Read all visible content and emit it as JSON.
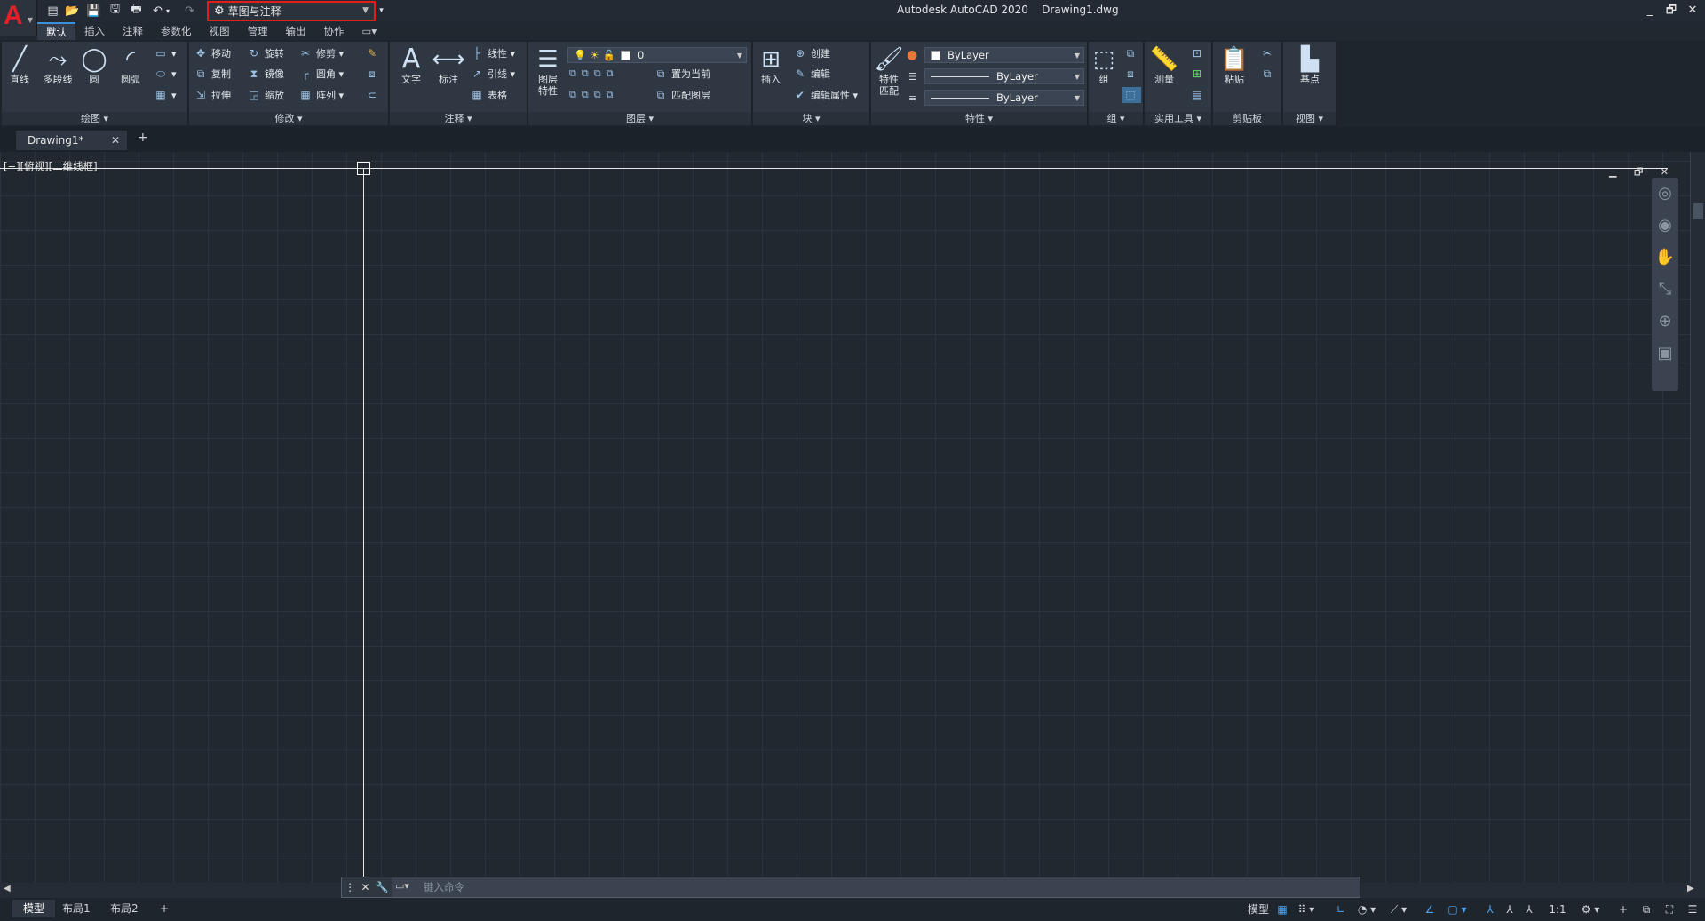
{
  "app": {
    "logo": "A",
    "title": "Autodesk AutoCAD 2020    Drawing1.dwg"
  },
  "workspace": {
    "name": "草图与注释"
  },
  "ribbon_tabs": [
    "默认",
    "插入",
    "注释",
    "参数化",
    "视图",
    "管理",
    "输出",
    "协作"
  ],
  "draw": {
    "line": "直线",
    "polyline": "多段线",
    "circle": "圆",
    "arc": "圆弧",
    "footer": "绘图 ▾"
  },
  "modify": {
    "move": "移动",
    "rotate": "旋转",
    "trim": "修剪",
    "copy": "复制",
    "mirror": "镜像",
    "fillet": "圆角",
    "stretch": "拉伸",
    "scale": "缩放",
    "array": "阵列",
    "footer": "修改 ▾"
  },
  "annotation": {
    "text": "文字",
    "dimension": "标注",
    "linear": "线性",
    "leader": "引线",
    "table": "表格",
    "footer": "注释 ▾"
  },
  "layers": {
    "properties": "图层\n特性",
    "current_layer": "0",
    "make_current": "置为当前",
    "match_layer": "匹配图层",
    "footer": "图层 ▾"
  },
  "block": {
    "insert": "插入",
    "create": "创建",
    "edit": "编辑",
    "edit_attributes": "编辑属性",
    "footer": "块 ▾"
  },
  "properties": {
    "match": "特性\n匹配",
    "color": "ByLayer",
    "linetype": "ByLayer",
    "lineweight": "ByLayer",
    "footer": "特性 ▾"
  },
  "groups": {
    "group": "组",
    "footer": "组 ▾"
  },
  "utilities": {
    "measure": "测量",
    "footer": "实用工具 ▾"
  },
  "clipboard": {
    "paste": "粘贴",
    "footer": "剪贴板"
  },
  "view": {
    "base": "基点",
    "footer": "视图 ▾"
  },
  "document": {
    "tab": "Drawing1*",
    "viewport_label": "[−][俯视][二维线框]"
  },
  "command": {
    "placeholder": "键入命令"
  },
  "layouts": [
    "模型",
    "布局1",
    "布局2"
  ],
  "status": {
    "model": "模型",
    "scale": "1:1"
  },
  "colors": {
    "accent": "#3d8fd8",
    "highlight": "#e11d1d",
    "background": "#212830"
  }
}
